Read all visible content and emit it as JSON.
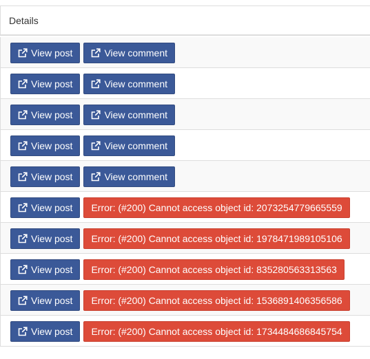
{
  "table": {
    "header": "Details",
    "view_post_label": "View post",
    "view_comment_label": "View comment",
    "icon": "external-link-icon",
    "rows": [
      {
        "post": "View post",
        "secondary_type": "comment",
        "secondary": "View comment"
      },
      {
        "post": "View post",
        "secondary_type": "comment",
        "secondary": "View comment"
      },
      {
        "post": "View post",
        "secondary_type": "comment",
        "secondary": "View comment"
      },
      {
        "post": "View post",
        "secondary_type": "comment",
        "secondary": "View comment"
      },
      {
        "post": "View post",
        "secondary_type": "comment",
        "secondary": "View comment"
      },
      {
        "post": "View post",
        "secondary_type": "error",
        "secondary": "Error: (#200) Cannot access object id: 2073254779665559"
      },
      {
        "post": "View post",
        "secondary_type": "error",
        "secondary": "Error: (#200) Cannot access object id: 1978471989105106"
      },
      {
        "post": "View post",
        "secondary_type": "error",
        "secondary": "Error: (#200) Cannot access object id: 835280563313563"
      },
      {
        "post": "View post",
        "secondary_type": "error",
        "secondary": "Error: (#200) Cannot access object id: 1536891406356586"
      },
      {
        "post": "View post",
        "secondary_type": "error",
        "secondary": "Error: (#200) Cannot access object id: 1734484686845754"
      }
    ]
  },
  "colors": {
    "primary": "#3b5998",
    "danger": "#dd4b39"
  }
}
